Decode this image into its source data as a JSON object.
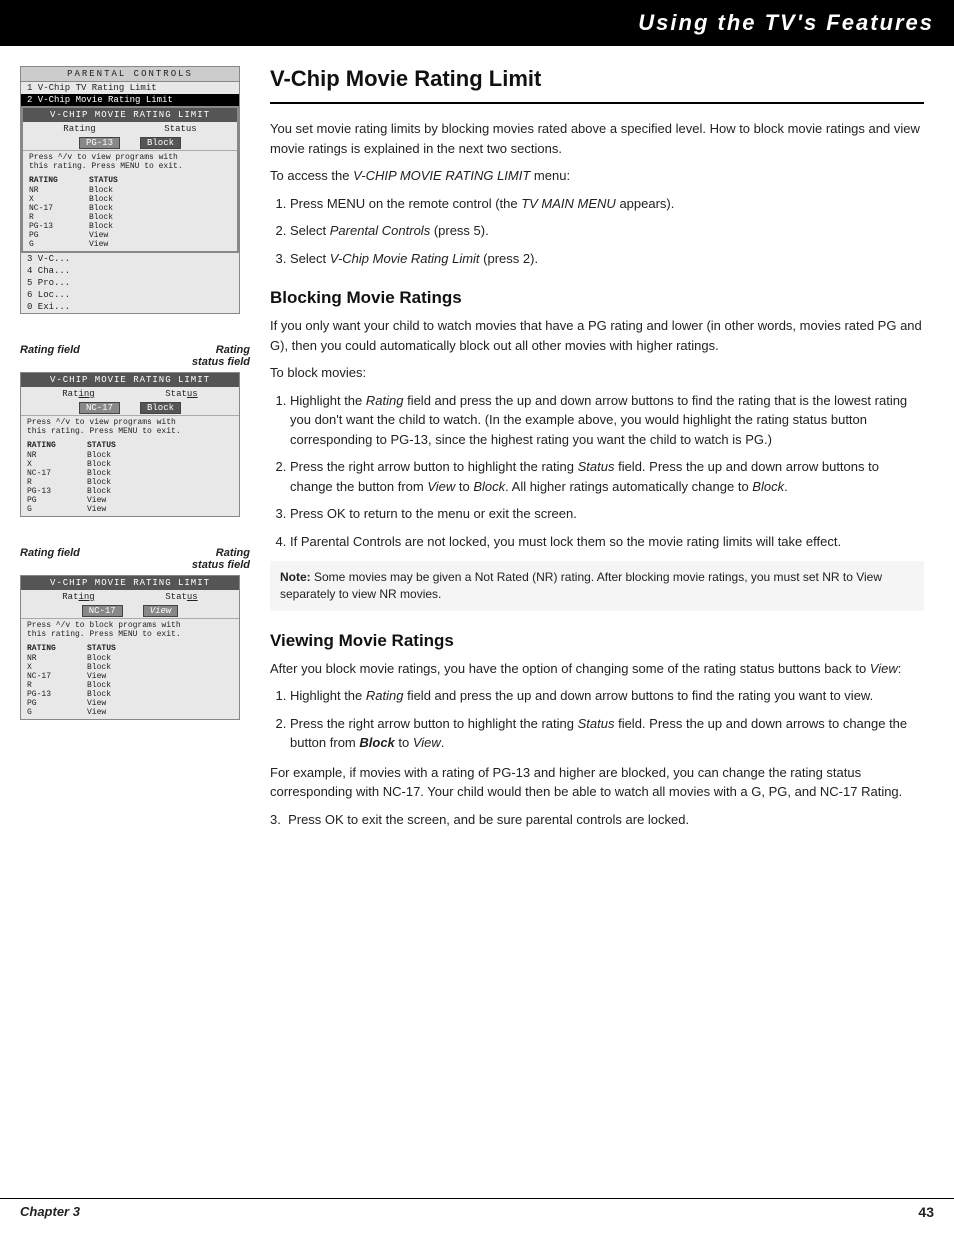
{
  "header": {
    "title": "Using the TV's Features"
  },
  "footer": {
    "chapter_label": "Chapter 3",
    "page_number": "43"
  },
  "left_panel": {
    "screen1": {
      "menu_title": "PARENTAL CONTROLS",
      "items": [
        "1 V-Chip TV Rating Limit",
        "2 V-Chip Movie Rating Limit",
        "3 V-C...",
        "4 Cha...",
        "5 Pro...",
        "6 Loc...",
        "0 Exi..."
      ],
      "selected_item": "2 V-Chip Movie Rating Limit",
      "submenu_title": "V-CHIP MOVIE RATING LIMIT",
      "submenu_cols": [
        "Rating",
        "Status"
      ],
      "submenu_selected_rating": "PG-13",
      "submenu_selected_status": "Block",
      "submenu_note": "Press ^/v to view programs with\nthis rating. Press MENU to exit.",
      "ratings": [
        {
          "rating": "NR",
          "status": "Block"
        },
        {
          "rating": "X",
          "status": "Block"
        },
        {
          "rating": "NC-17",
          "status": "Block"
        },
        {
          "rating": "R",
          "status": "Block"
        },
        {
          "rating": "PG-13",
          "status": "Block"
        },
        {
          "rating": "PG",
          "status": "View"
        },
        {
          "rating": "G",
          "status": "View"
        }
      ]
    },
    "screen2": {
      "label_left": "Rating field",
      "label_right": "Rating\nstatus field",
      "submenu_title": "V-CHIP MOVIE RATING LIMIT",
      "submenu_cols": [
        "Rating",
        "Status"
      ],
      "submenu_selected_rating": "NC-17",
      "submenu_selected_status": "Block",
      "submenu_note": "Press ^/v to view programs with\nthis rating. Press MENU to exit.",
      "ratings": [
        {
          "rating": "NR",
          "status": "Block"
        },
        {
          "rating": "X",
          "status": "Block"
        },
        {
          "rating": "NC-17",
          "status": "Block"
        },
        {
          "rating": "R",
          "status": "Block"
        },
        {
          "rating": "PG-13",
          "status": "Block"
        },
        {
          "rating": "PG",
          "status": "View"
        },
        {
          "rating": "G",
          "status": "View"
        }
      ]
    },
    "screen3": {
      "label_left": "Rating field",
      "label_right": "Rating\nstatus field",
      "submenu_title": "V-CHIP MOVIE RATING LIMIT",
      "submenu_cols": [
        "Rating",
        "Status"
      ],
      "submenu_selected_rating": "NC-17",
      "submenu_selected_status": "View",
      "submenu_note": "Press ^/v to block programs with\nthis rating. Press MENU to exit.",
      "ratings": [
        {
          "rating": "NR",
          "status": "Block"
        },
        {
          "rating": "X",
          "status": "Block"
        },
        {
          "rating": "NC-17",
          "status": "View"
        },
        {
          "rating": "R",
          "status": "Block"
        },
        {
          "rating": "PG-13",
          "status": "Block"
        },
        {
          "rating": "PG",
          "status": "View"
        },
        {
          "rating": "G",
          "status": "View"
        }
      ]
    }
  },
  "main_content": {
    "section1": {
      "title": "V-Chip Movie Rating Limit",
      "intro": "You set movie rating limits by blocking movies rated above a specified level. How to block movie ratings and view movie ratings is explained in the next two sections.",
      "access_text": "To access the V-CHIP MOVIE RATING LIMIT menu:",
      "steps": [
        "Press MENU on the remote control (the TV MAIN MENU appears).",
        "Select Parental Controls (press 5).",
        "Select V-Chip Movie Rating Limit (press 2)."
      ]
    },
    "section2": {
      "title": "Blocking Movie Ratings",
      "intro": "If you only want your child to watch movies that have a PG rating and lower (in other words, movies rated PG and G), then you could automatically block out all other movies with higher ratings.",
      "to_block_label": "To block movies:",
      "steps": [
        "Highlight the Rating field and press the up and down arrow buttons to find the rating that is the lowest rating you don't want the child to watch.  (In the example above, you would highlight the rating status button corresponding to PG-13, since the highest rating you want the child to watch is PG.)",
        "Press the right arrow button to highlight the rating Status field. Press the up and down arrow buttons to change the button from View to Block. All higher ratings automatically change to Block.",
        "Press OK to return to the menu or exit the screen.",
        "If Parental Controls are not locked, you must lock them so the movie rating limits will take effect."
      ],
      "note": "Note: Some movies may be given a Not Rated (NR) rating. After blocking movie ratings, you must set NR to View separately to view NR movies."
    },
    "section3": {
      "title": "Viewing Movie Ratings",
      "intro": "After you block movie ratings, you have the option of changing some of the rating status buttons back to View:",
      "steps": [
        "Highlight the Rating field and press the up and down arrow buttons to find the rating you want to view.",
        "Press the right arrow button to highlight the rating Status field. Press the up and down arrows to change the button from Block to View."
      ],
      "outro": "For example, if movies with a rating of PG-13 and higher are blocked, you can change the rating status corresponding with NC-17. Your child would then be able to watch all movies with a G, PG, and NC-17 Rating.",
      "final_step": "Press OK to exit the screen, and be sure parental controls are locked."
    }
  }
}
